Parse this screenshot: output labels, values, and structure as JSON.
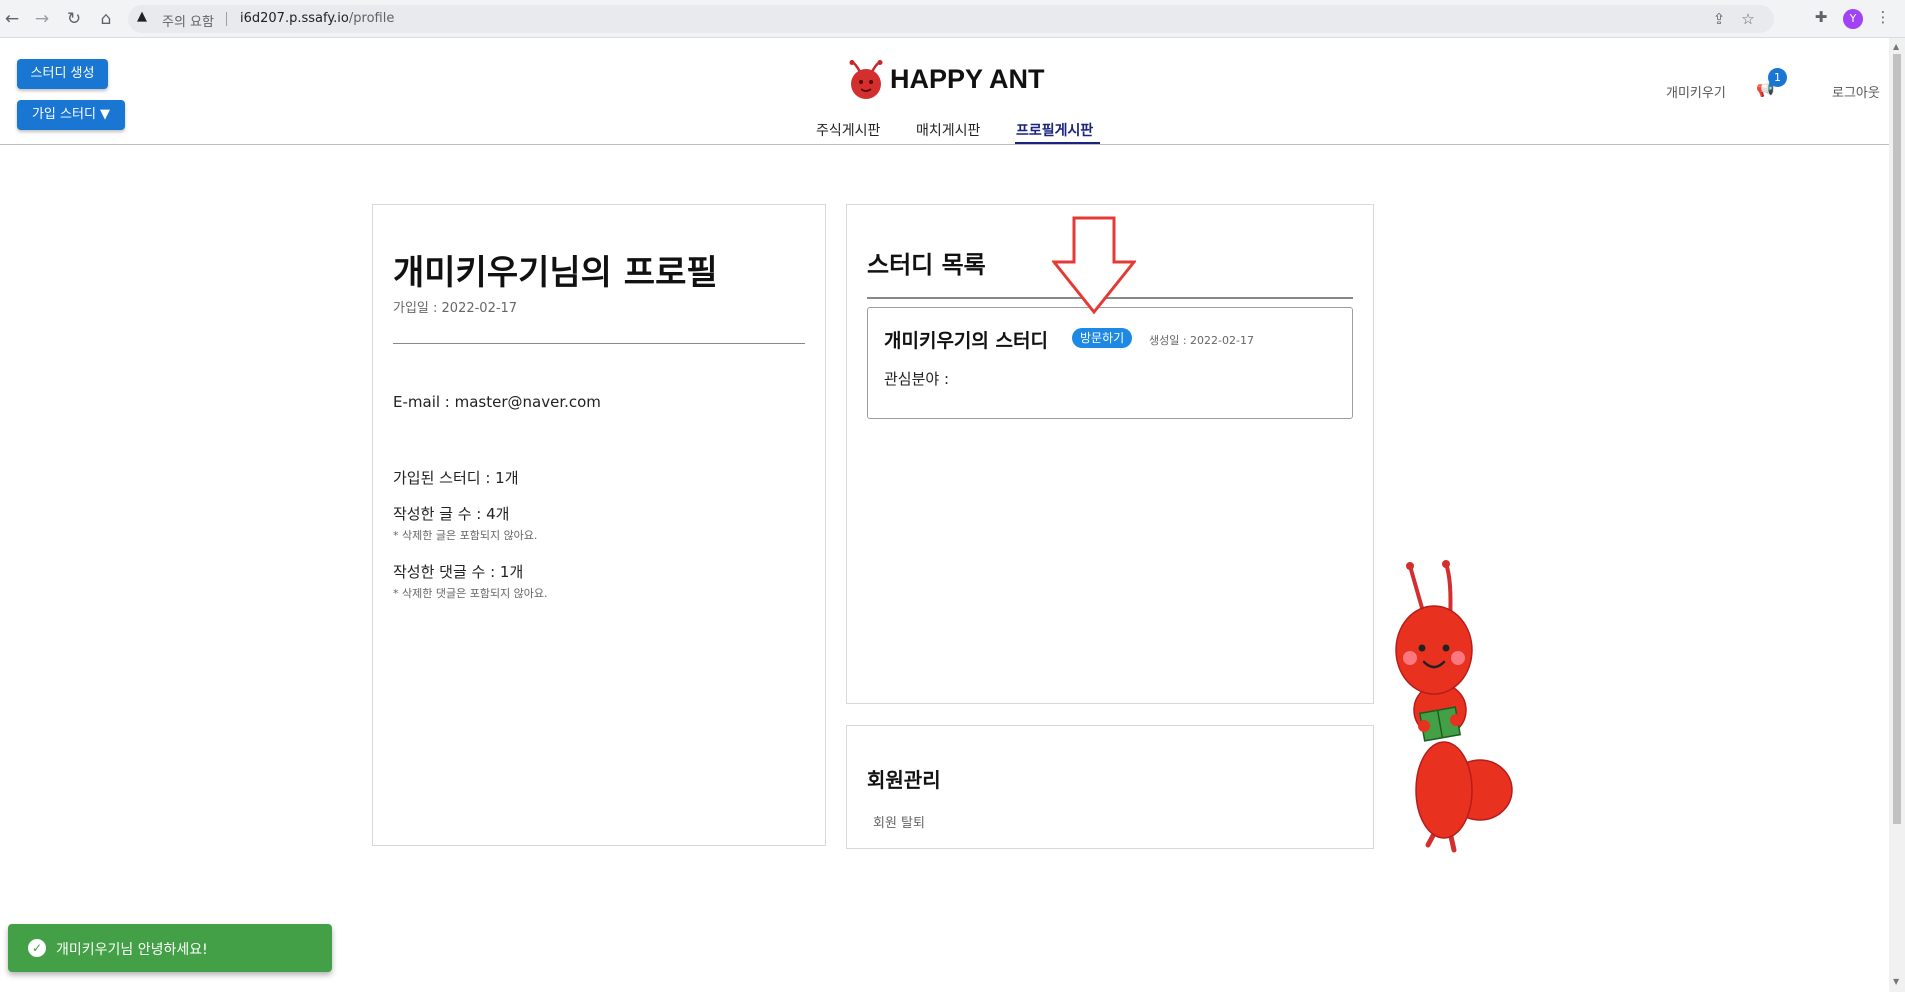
{
  "browser": {
    "security_label": "주의 요함",
    "url_host": "i6d207.p.ssafy.io",
    "url_path": "/profile",
    "avatar_letter": "Y"
  },
  "header": {
    "create_study_label": "스터디 생성",
    "joined_study_label": "가입 스터디 ▼",
    "logo_text": "HAPPY ANT",
    "nav": [
      {
        "label": "주식게시판",
        "active": false
      },
      {
        "label": "매치게시판",
        "active": false
      },
      {
        "label": "프로필게시판",
        "active": true
      }
    ],
    "username": "개미키우기",
    "notification_count": "1",
    "logout_label": "로그아웃"
  },
  "profile": {
    "title": "개미키우기님의 프로필",
    "joined_date": "가입일 : 2022-02-17",
    "email": "E-mail : master@naver.com",
    "joined_studies": "가입된 스터디 : 1개",
    "post_count": "작성한 글 수 : 4개",
    "post_note": "* 삭제한 글은 포함되지 않아요.",
    "comment_count": "작성한 댓글 수 : 1개",
    "comment_note": "* 삭제한 댓글은 포함되지 않아요."
  },
  "studies": {
    "title": "스터디 목록",
    "items": [
      {
        "name": "개미키우기의 스터디",
        "visit_label": "방문하기",
        "created": "생성일 : 2022-02-17",
        "interest": "관심분야 :"
      }
    ]
  },
  "member": {
    "title": "회원관리",
    "withdraw_label": "회원 탈퇴"
  },
  "toast": {
    "message": "개미키우기님 안녕하세요!"
  },
  "colors": {
    "primary": "#1976d2",
    "active_nav": "#1a237e",
    "toast": "#43a047",
    "ant_red": "#e8321f"
  },
  "icons": [
    "back-arrow-icon",
    "forward-arrow-icon",
    "reload-icon",
    "home-icon",
    "warning-icon",
    "share-icon",
    "star-icon",
    "extension-icon",
    "menu-dots-icon",
    "megaphone-icon",
    "check-circle-icon"
  ]
}
